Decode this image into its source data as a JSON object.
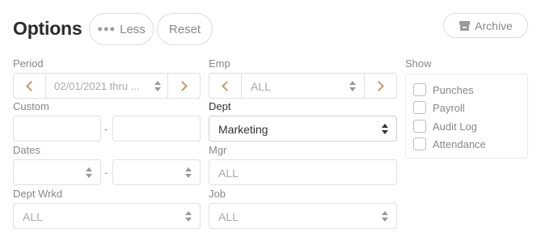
{
  "header": {
    "title": "Options",
    "less_label": "Less",
    "reset_label": "Reset",
    "archive_label": "Archive"
  },
  "filters": {
    "period": {
      "label": "Period",
      "value": "02/01/2021 thru ..."
    },
    "emp": {
      "label": "Emp",
      "value": "ALL"
    },
    "custom": {
      "label": "Custom",
      "start": "",
      "end": "",
      "separator": "-"
    },
    "dept": {
      "label": "Dept",
      "value": "Marketing"
    },
    "dates": {
      "label": "Dates",
      "start": "",
      "end": "",
      "separator": "-"
    },
    "mgr": {
      "label": "Mgr",
      "value": "ALL"
    },
    "dept_wrkd": {
      "label": "Dept Wrkd",
      "value": "ALL"
    },
    "job": {
      "label": "Job",
      "value": "ALL"
    }
  },
  "show": {
    "label": "Show",
    "options": [
      {
        "label": "Punches",
        "checked": false
      },
      {
        "label": "Payroll",
        "checked": false
      },
      {
        "label": "Audit Log",
        "checked": false
      },
      {
        "label": "Attendance",
        "checked": false
      }
    ]
  },
  "colors": {
    "accent": "#c49a6c",
    "border": "#e0e0e0",
    "muted_text": "#888888",
    "title": "#2b2b2b"
  }
}
